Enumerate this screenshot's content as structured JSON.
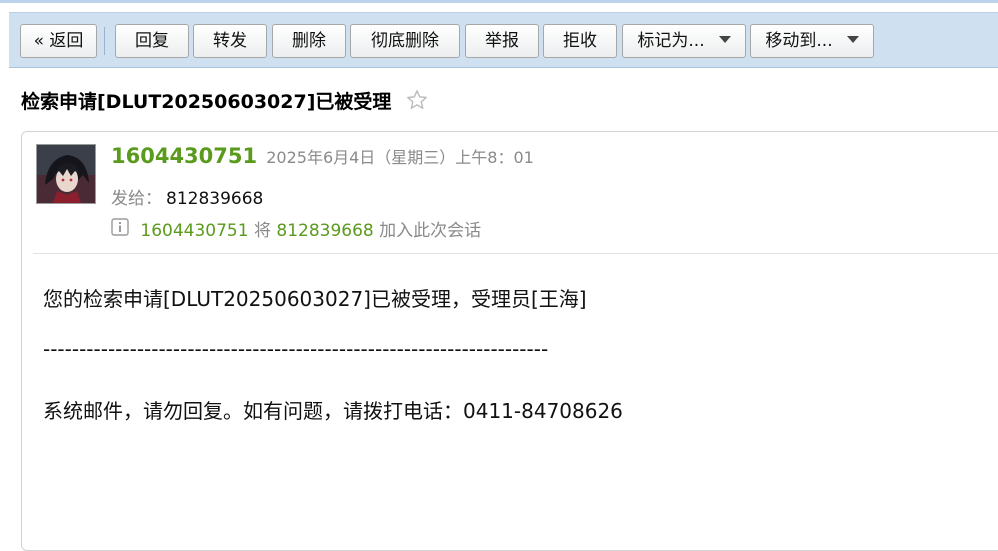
{
  "toolbar": {
    "back": "« 返回",
    "reply": "回复",
    "forward": "转发",
    "delete": "删除",
    "delete_forever": "彻底删除",
    "report": "举报",
    "reject": "拒收",
    "mark_as": "标记为...",
    "move_to": "移动到..."
  },
  "email": {
    "subject": "检索申请[DLUT20250603027]已被受理",
    "sender": "1604430751",
    "time": "2025年6月4日（星期三）上午8：01",
    "to_label": "发给：",
    "to_value": "812839668",
    "notice": {
      "actor": "1604430751",
      "verb": " 将 ",
      "target": "812839668",
      "action": " 加入此次会话"
    },
    "body": {
      "line1": "您的检索申请[DLUT20250603027]已被受理，受理员[王海]",
      "separator": "----------------------------------------------------------------------",
      "line2": "系统邮件，请勿回复。如有问题，请拨打电话：0411-84708626"
    }
  },
  "colors": {
    "toolbar_bg": "#cfe0f1",
    "sender_green": "#5a9a1d",
    "muted_grey": "#8a8a8a"
  },
  "icons": {
    "star": "star-outline-icon",
    "info": "info-icon",
    "caret": "chevron-down-icon"
  }
}
